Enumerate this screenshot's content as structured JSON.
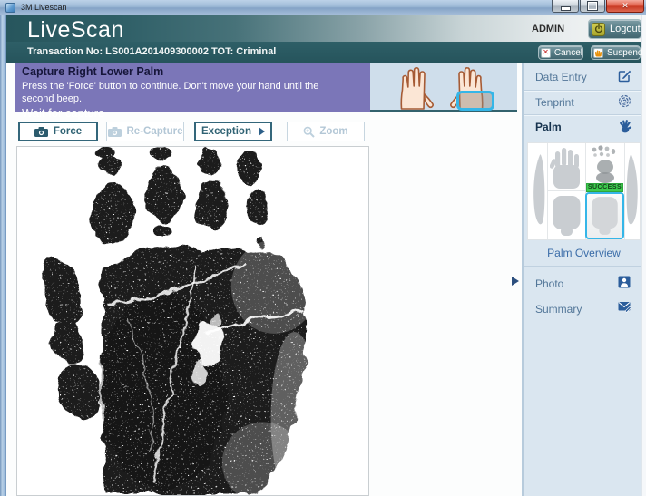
{
  "window": {
    "title": "3M Livescan"
  },
  "header": {
    "app_name": "LiveScan",
    "user_label": "ADMIN",
    "logout_label": "Logout"
  },
  "transaction": {
    "label": "Transaction No: LS001A201409300002 TOT: Criminal",
    "cancel_label": "Cancel",
    "suspend_label": "Suspend"
  },
  "instruction": {
    "title": "Capture Right Lower Palm",
    "body": "Press the 'Force' button to continue. Don't move your hand until the second beep.",
    "status": "Wait for capture"
  },
  "toolbar": {
    "force_label": "Force",
    "recapture_label": "Re-Capture",
    "exception_label": "Exception",
    "zoom_label": "Zoom"
  },
  "sidebar": {
    "data_entry_label": "Data Entry",
    "tenprint_label": "Tenprint",
    "palm_label": "Palm",
    "palm_overview_label": "Palm Overview",
    "photo_label": "Photo",
    "summary_label": "Summary",
    "success_badge": "SUCCESS"
  },
  "icons": {
    "close_glyph": "✕",
    "cancel_glyph": "✕"
  },
  "colors": {
    "instruction_purple": "#7b76b8",
    "header_teal": "#27565d",
    "transaction_teal": "#2a5a61",
    "highlight_cyan": "#35b6e8",
    "success_green": "#3ecb4e",
    "sidebar_bg": "#dae6f0",
    "sidebar_accent_blue": "#2b5d9b",
    "button_teal": "#567d87"
  }
}
